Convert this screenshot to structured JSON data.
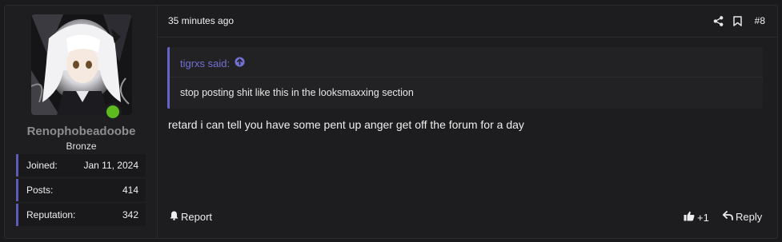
{
  "user": {
    "username": "Renophobeadoobe",
    "title": "Bronze",
    "online": true,
    "stats": [
      {
        "label": "Joined:",
        "value": "Jan 11, 2024"
      },
      {
        "label": "Posts:",
        "value": "414"
      },
      {
        "label": "Reputation:",
        "value": "342"
      }
    ]
  },
  "post": {
    "timestamp": "35 minutes ago",
    "number": "#8",
    "quote": {
      "author_line": "tigrxs said:",
      "text": "stop posting shit like this in the looksmaxxing section"
    },
    "message": "retard i can tell you have some pent up anger get off the forum for a day",
    "actions": {
      "report_label": "Report",
      "reaction_count": "+1",
      "reply_label": "Reply"
    }
  },
  "icons": {
    "share": "share-icon",
    "bookmark": "bookmark-icon",
    "quote_link": "arrow-up-circle-icon",
    "report": "bell-icon",
    "like": "thumbs-up-icon",
    "reply": "reply-arrow-icon"
  },
  "colors": {
    "accent": "#6563c6",
    "online": "#5dbb1f",
    "background": "#1d1d1f"
  }
}
